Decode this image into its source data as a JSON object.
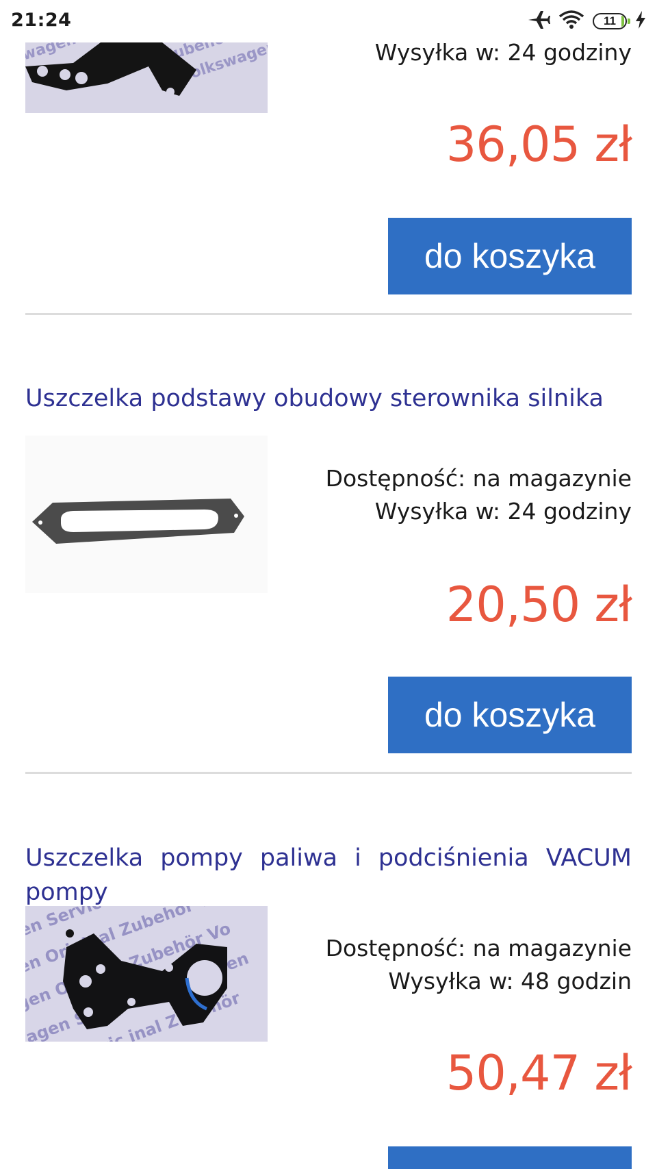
{
  "status_bar": {
    "time": "21:24",
    "battery": "11",
    "icons": [
      "airplane-icon",
      "wifi-icon",
      "battery-icon",
      "charging-icon"
    ]
  },
  "colors": {
    "title": "#2e3192",
    "price": "#e8573f",
    "button": "#2f6fc4",
    "divider": "#dcdcdc"
  },
  "products": [
    {
      "title": "",
      "availability": "",
      "shipping": "Wysyłka w: 24 godziny",
      "price": "36,05 zł",
      "button": "do koszyka",
      "image": "vw-gasket-black-bracket"
    },
    {
      "title": "Uszczelka podstawy obudowy sterownika silnika",
      "availability": "Dostępność: na magazynie",
      "shipping": "Wysyłka w: 24 godziny",
      "price": "20,50 zł",
      "button": "do koszyka",
      "image": "gray-oval-gasket"
    },
    {
      "title": "Uszczelka pompy paliwa i podciśnienia VACUM pompy",
      "availability": "Dostępność: na magazynie",
      "shipping": "Wysyłka w: 48 godzin",
      "price": "50,47 zł",
      "button": "",
      "image": "vw-fuel-pump-gasket"
    }
  ]
}
